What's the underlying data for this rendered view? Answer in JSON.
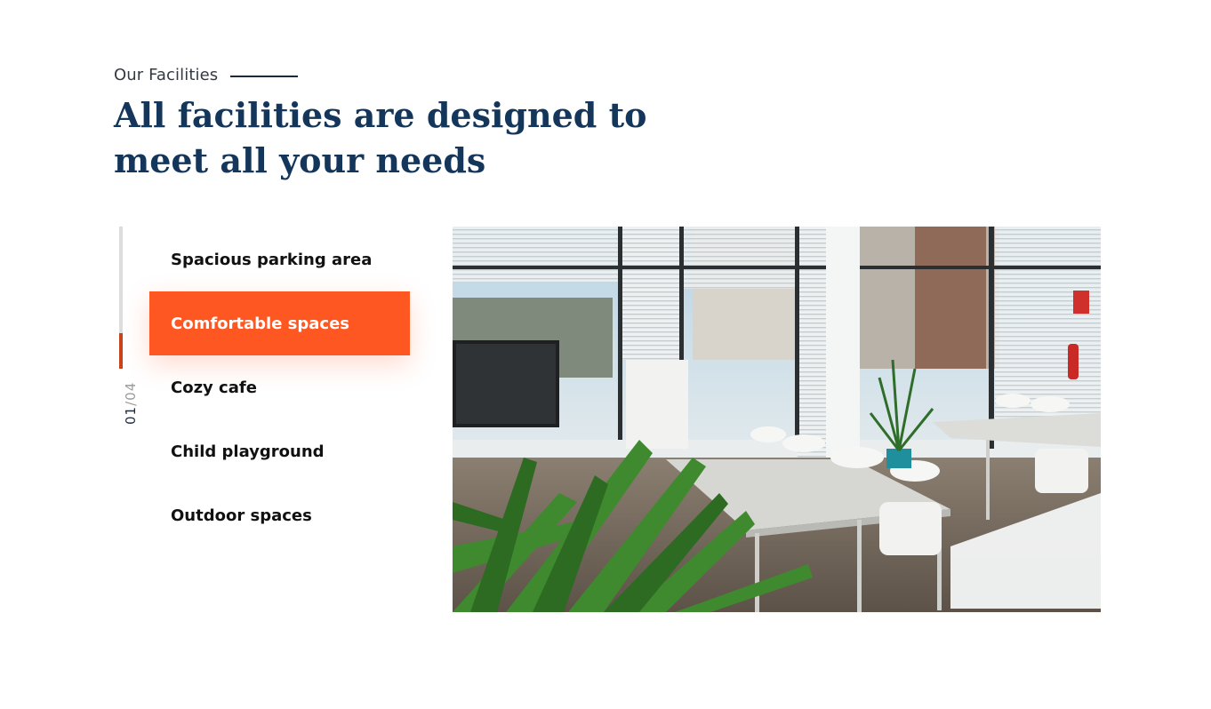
{
  "section": {
    "eyebrow": "Our Facilities",
    "headline": "All facilities are designed to meet all your needs"
  },
  "tabs": {
    "items": [
      {
        "label": "Spacious parking area"
      },
      {
        "label": "Comfortable spaces"
      },
      {
        "label": "Cozy cafe"
      },
      {
        "label": "Child playground"
      },
      {
        "label": "Outdoor spaces"
      }
    ],
    "active_index": 1
  },
  "progress": {
    "current": "01",
    "total": "/04",
    "fraction": 0.25
  },
  "photo": {
    "subject": "Bright coworking room with white tables and chairs, window blinds, a TV screen and potted palm plants"
  },
  "colors": {
    "accent": "#ff5722",
    "headline": "#13365a",
    "progress_fill": "#c8421a"
  }
}
